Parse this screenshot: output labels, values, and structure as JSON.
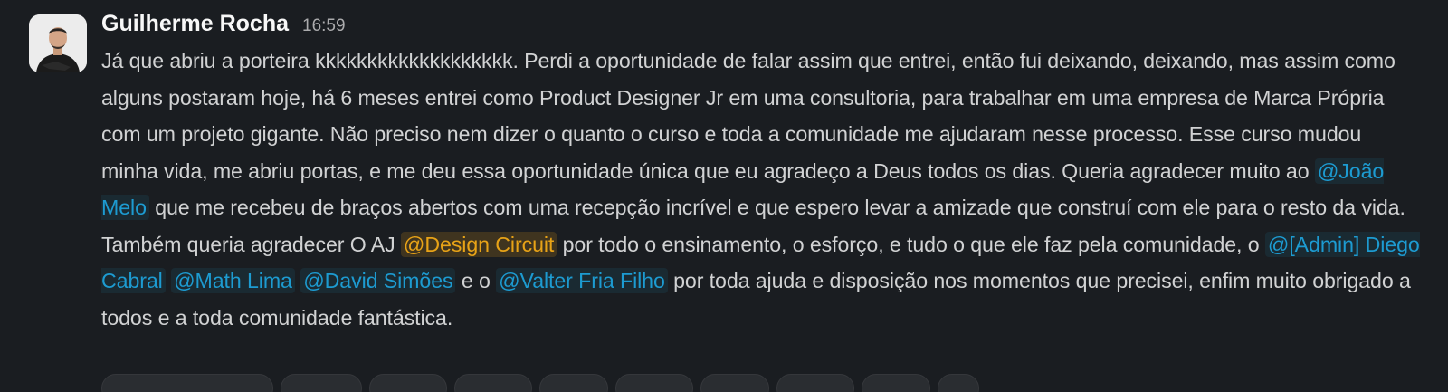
{
  "message": {
    "author": "Guilherme Rocha",
    "time": "16:59",
    "segments": {
      "s1": "Já que abriu a porteira kkkkkkkkkkkkkkkkkkk. Perdi a oportunidade de falar assim que entrei, então fui deixando, deixando, mas assim como alguns postaram hoje, há 6 meses entrei como Product Designer Jr em uma consultoria, para trabalhar em uma empresa de Marca Própria com um projeto gigante. Não preciso nem dizer o quanto o curso e toda a comunidade me ajudaram nesse processo. Esse curso mudou minha vida, me abriu portas, e me deu essa oportunidade única que eu agradeço a Deus todos os dias. Queria agradecer muito ao ",
      "m1": "@João Melo",
      "s2": " que me recebeu de braços abertos com uma recepção incrível e que espero levar a amizade que construí com ele para o resto da vida. Também queria agradecer O AJ ",
      "m2": "@Design Circuit",
      "s3": " por todo o ensinamento, o esforço, e tudo o que ele faz pela comunidade, o ",
      "m3": "@[Admin] Diego Cabral",
      "s4": " ",
      "m4": "@Math Lima",
      "s5": " ",
      "m5": "@David Simões",
      "s6": " e o ",
      "m6": "@Valter Fria Filho",
      "s7": " por toda ajuda e disposição nos momentos que precisei, enfim muito obrigado a todos e a toda comunidade fantástica."
    }
  },
  "colors": {
    "background": "#1a1d21",
    "text": "#d1d2d3",
    "mention_user": "#1d9bd1",
    "mention_group": "#e8a317"
  }
}
